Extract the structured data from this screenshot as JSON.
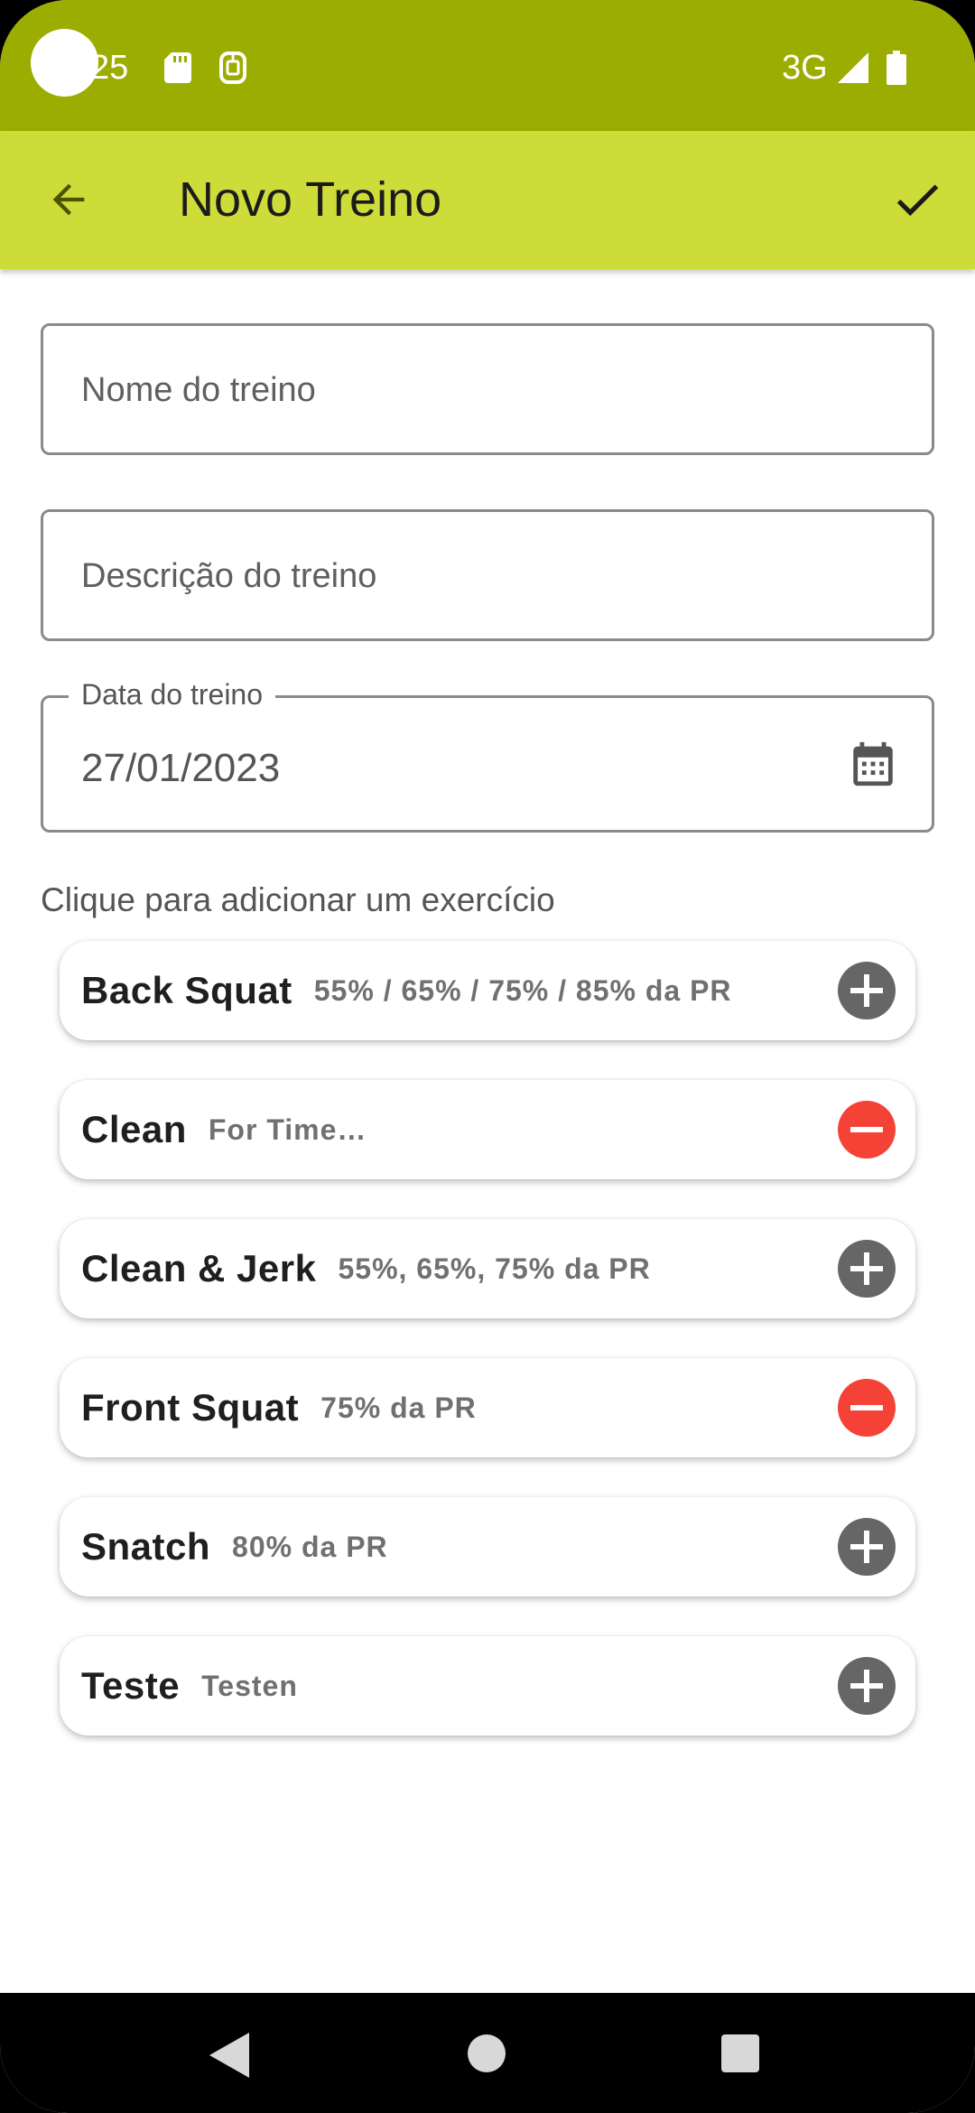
{
  "status_bar": {
    "time": "25",
    "network": "3G",
    "icons": [
      "sd-card-icon",
      "sim-icon",
      "signal-icon",
      "battery-icon"
    ]
  },
  "app_bar": {
    "title": "Novo Treino",
    "back_icon": "arrow-back-icon",
    "confirm_icon": "check-icon"
  },
  "form": {
    "name_placeholder": "Nome do treino",
    "description_placeholder": "Descrição do treino",
    "date_label": "Data do treino",
    "date_value": "27/01/2023"
  },
  "exercises_hint": "Clique para adicionar um exercício",
  "exercises": [
    {
      "name": "Back Squat",
      "description": "55% / 65% / 75% / 85% da PR",
      "action": "add"
    },
    {
      "name": "Clean",
      "description": "For Time…",
      "action": "remove"
    },
    {
      "name": "Clean & Jerk",
      "description": "55%, 65%, 75% da PR",
      "action": "add"
    },
    {
      "name": "Front Squat",
      "description": "75% da PR",
      "action": "remove"
    },
    {
      "name": "Snatch",
      "description": "80% da PR",
      "action": "add"
    },
    {
      "name": "Teste",
      "description": "Testen",
      "action": "add"
    }
  ],
  "colors": {
    "status_bar": "#9bad00",
    "app_bar": "#cddc39",
    "add_button": "#666666",
    "remove_button": "#f44336"
  }
}
